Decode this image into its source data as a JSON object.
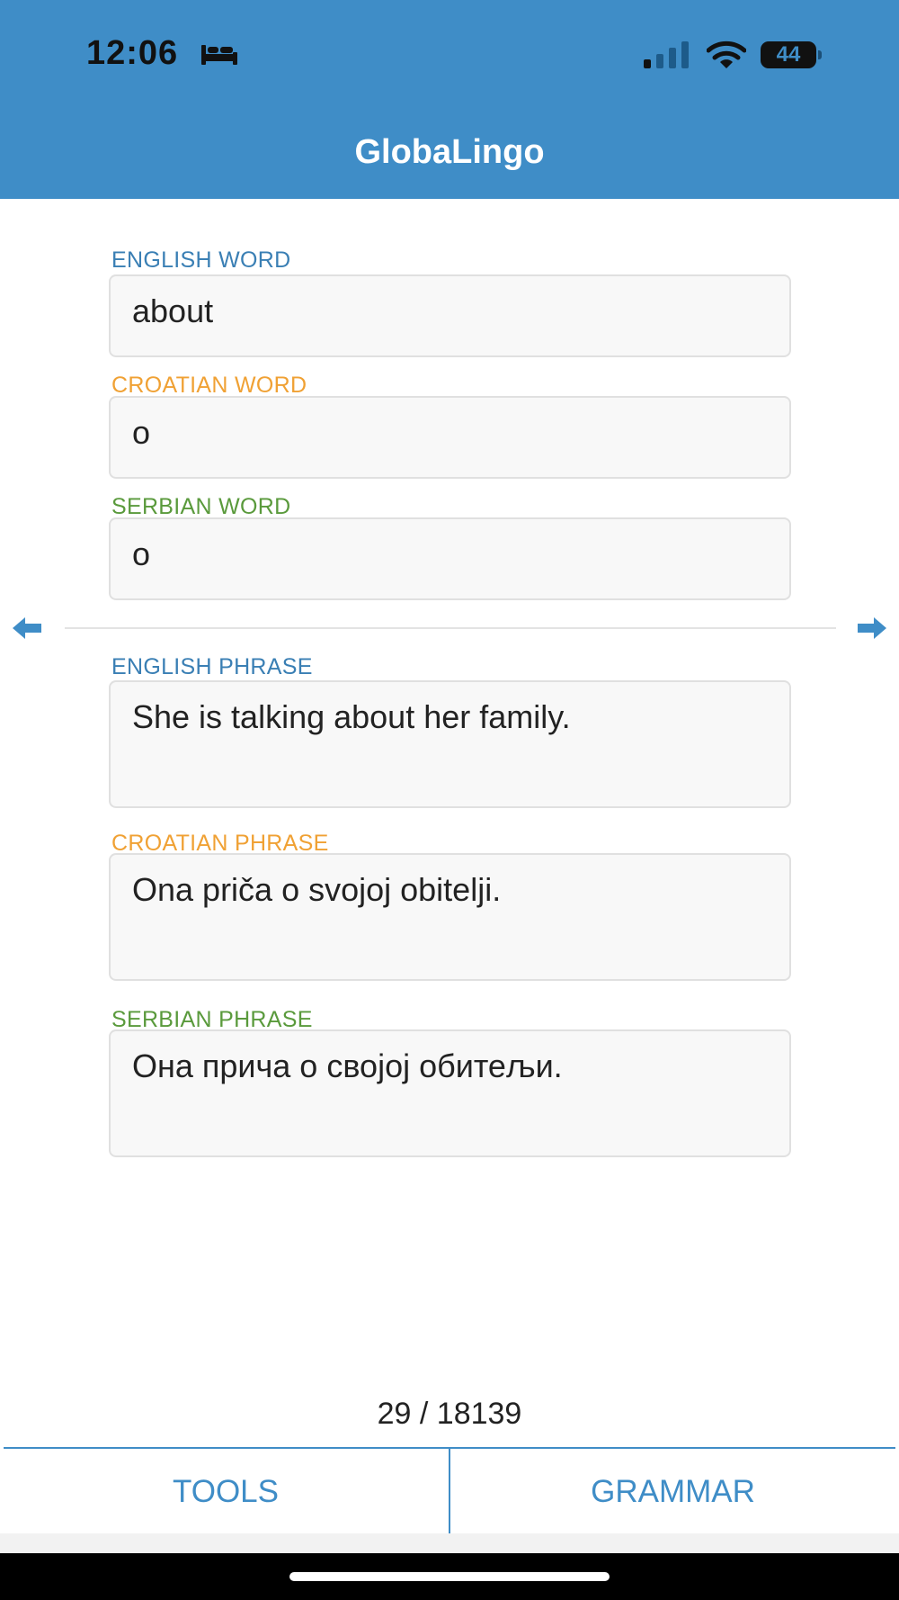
{
  "status_bar": {
    "time": "12:06",
    "battery": "44"
  },
  "header": {
    "title": "GlobaLingo"
  },
  "fields": {
    "english_word": {
      "label": "ENGLISH WORD",
      "value": "about"
    },
    "croatian_word": {
      "label": "CROATIAN WORD",
      "value": "o"
    },
    "serbian_word": {
      "label": "SERBIAN WORD",
      "value": "о"
    },
    "english_phrase": {
      "label": "ENGLISH PHRASE",
      "value": "She is talking about her family."
    },
    "croatian_phrase": {
      "label": "CROATIAN PHRASE",
      "value": "Ona priča o svojoj obitelji."
    },
    "serbian_phrase": {
      "label": "SERBIAN PHRASE",
      "value": "Она прича о својој обитељи."
    }
  },
  "counter": "29 / 18139",
  "toolbar": {
    "tools_label": "TOOLS",
    "grammar_label": "GRAMMAR"
  },
  "colors": {
    "header_blue": "#3f8dc7",
    "english_label": "#3a7fb4",
    "croatian_label": "#f0a134",
    "serbian_label": "#5a9a3c"
  },
  "icons": {
    "sleep": "bed-icon",
    "cellular": "signal-icon",
    "wifi": "wifi-icon",
    "previous": "arrow-left-icon",
    "next": "arrow-right-icon"
  }
}
